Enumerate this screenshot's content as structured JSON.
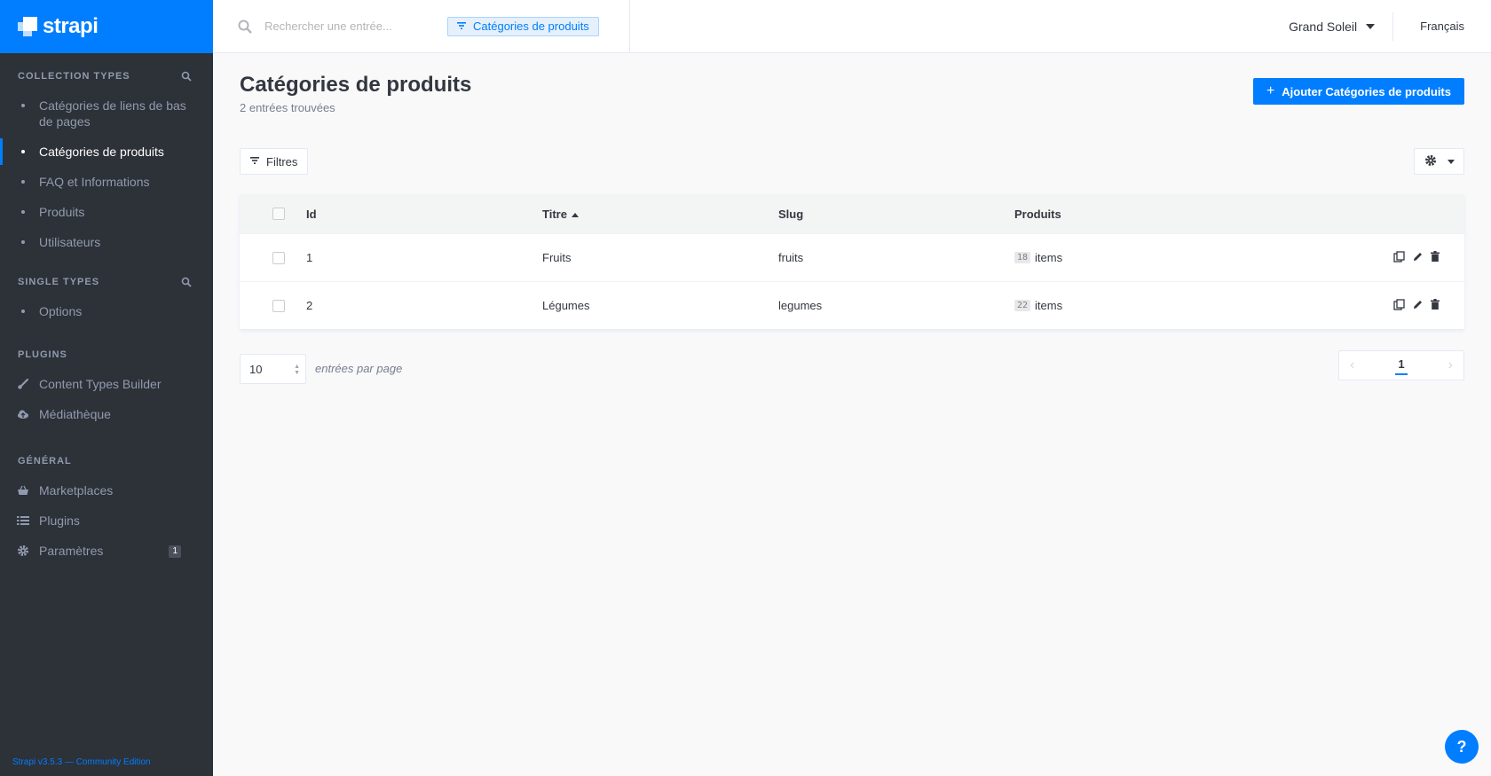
{
  "brand": {
    "name": "strapi"
  },
  "sidebar": {
    "collection_types": {
      "title": "COLLECTION TYPES",
      "items": [
        {
          "label": "Catégories de liens de bas de pages"
        },
        {
          "label": "Catégories de produits"
        },
        {
          "label": "FAQ et Informations"
        },
        {
          "label": "Produits"
        },
        {
          "label": "Utilisateurs"
        }
      ]
    },
    "single_types": {
      "title": "SINGLE TYPES",
      "items": [
        {
          "label": "Options"
        }
      ]
    },
    "plugins": {
      "title": "PLUGINS",
      "items": [
        {
          "label": "Content Types Builder",
          "icon": "brush-icon"
        },
        {
          "label": "Médiathèque",
          "icon": "cloud-upload-icon"
        }
      ]
    },
    "general": {
      "title": "GÉNÉRAL",
      "items": [
        {
          "label": "Marketplaces",
          "icon": "basket-icon"
        },
        {
          "label": "Plugins",
          "icon": "list-icon"
        },
        {
          "label": "Paramètres",
          "icon": "gear-icon",
          "badge": "1"
        }
      ]
    },
    "footer": "Strapi v3.5.3 — Community Edition"
  },
  "header": {
    "search_placeholder": "Rechercher une entrée...",
    "filter_chip": "Catégories de produits",
    "user": "Grand Soleil",
    "language": "Français"
  },
  "main": {
    "title": "Catégories de produits",
    "subtitle": "2 entrées trouvées",
    "add_button": "Ajouter Catégories de produits",
    "filters_button": "Filtres",
    "table": {
      "headers": {
        "id": "Id",
        "titre": "Titre",
        "slug": "Slug",
        "produits": "Produits"
      },
      "rows": [
        {
          "id": "1",
          "titre": "Fruits",
          "slug": "fruits",
          "count": "18",
          "items": "items"
        },
        {
          "id": "2",
          "titre": "Légumes",
          "slug": "legumes",
          "count": "22",
          "items": "items"
        }
      ]
    },
    "per_page": "10",
    "per_page_label": "entrées par page",
    "current_page": "1"
  },
  "colors": {
    "accent": "#007eff",
    "sidebar_bg": "#2d3138",
    "page_bg": "#f9f9fa"
  }
}
